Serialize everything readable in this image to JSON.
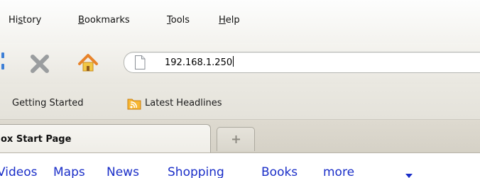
{
  "menubar": {
    "items": [
      {
        "pre": "Hi",
        "mnemonic": "s",
        "post": "tory"
      },
      {
        "pre": "",
        "mnemonic": "B",
        "post": "ookmarks"
      },
      {
        "pre": "",
        "mnemonic": "T",
        "post": "ools"
      },
      {
        "pre": "",
        "mnemonic": "H",
        "post": "elp"
      }
    ]
  },
  "navbar": {
    "url": "192.168.1.250",
    "icons": [
      "back-forward-icon",
      "stop-icon",
      "home-icon",
      "page-icon"
    ],
    "colors": {
      "stop": "#9a9d9f",
      "home_roof": "#e8832a",
      "home_body": "#f2c744"
    }
  },
  "bookmarks": {
    "items": [
      "Getting Started",
      "Latest Headlines"
    ],
    "icons": [
      "rss-feed-icon"
    ],
    "rss_color": "#f29b1d"
  },
  "tabs": {
    "active_label": "ox Start Page",
    "new_tab_icon": "plus-icon"
  },
  "content": {
    "links": [
      "Videos",
      "Maps",
      "News",
      "Shopping",
      "Books",
      "more"
    ],
    "more_icon": "dropdown-caret-icon",
    "link_color": "#1a2ec8"
  }
}
